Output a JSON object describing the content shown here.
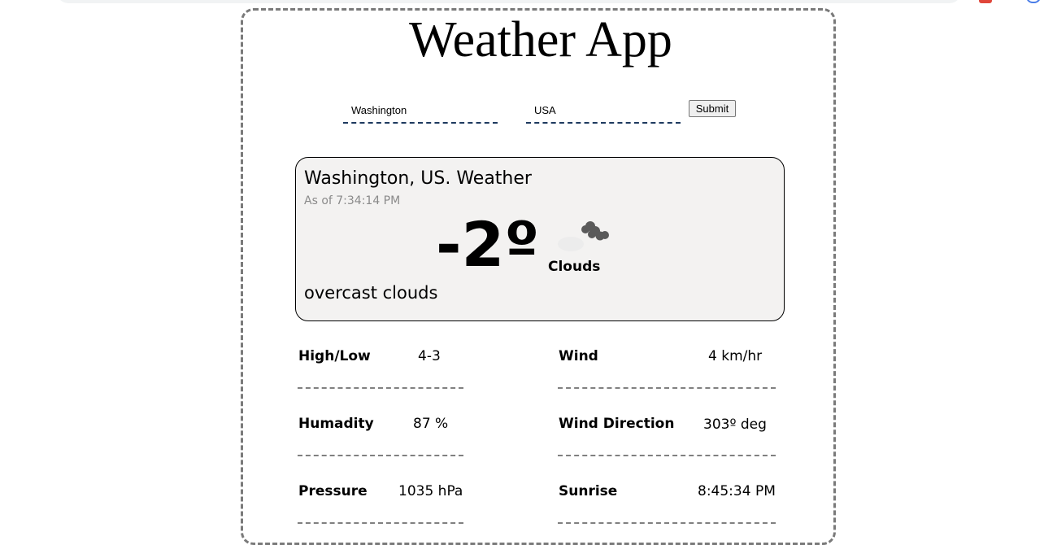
{
  "app": {
    "title": "Weather App"
  },
  "search": {
    "city_value": "Washington",
    "country_value": "USA",
    "submit_label": "Submit"
  },
  "current": {
    "location_title": "Washington, US. Weather",
    "as_of": "As of 7:34:14 PM",
    "temperature": "-2º",
    "condition_main": "Clouds",
    "condition_description": "overcast clouds",
    "icon": "overcast-clouds-icon"
  },
  "stats": {
    "high_low": {
      "label": "High/Low",
      "value": "4-3"
    },
    "humidity": {
      "label": "Humadity",
      "value": "87 %"
    },
    "pressure": {
      "label": "Pressure",
      "value": "1035 hPa"
    },
    "wind": {
      "label": "Wind",
      "value": "4 km/hr"
    },
    "wind_direction": {
      "label": "Wind Direction",
      "value": "303º deg"
    },
    "sunrise": {
      "label": "Sunrise",
      "value": "8:45:34 PM"
    }
  },
  "colors": {
    "frame_border": "#7a7a7a",
    "card_background": "#f3f2f1",
    "input_underline": "#1e3a5f",
    "divider": "#808080"
  }
}
